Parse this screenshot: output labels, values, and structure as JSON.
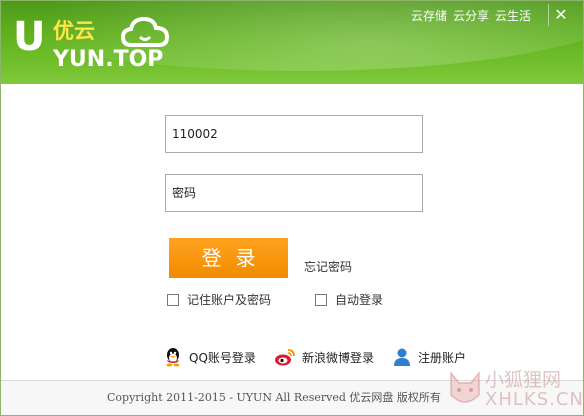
{
  "header": {
    "logo_cn": "优云",
    "logo_en": "YUN.TOP",
    "logo_u": "U",
    "links": [
      "云存储",
      "云分享",
      "云生活"
    ],
    "close": "✕"
  },
  "form": {
    "username_value": "110002",
    "password_placeholder": "密码",
    "login_label": "登录",
    "forgot_label": "忘记密码",
    "remember_label": "记住账户及密码",
    "auto_login_label": "自动登录"
  },
  "social": {
    "qq_label": "QQ账号登录",
    "weibo_label": "新浪微博登录",
    "register_label": "注册账户"
  },
  "footer": {
    "copyright": "Copyright 2011-2015 - UYUN All Reserved  优云网盘 版权所有"
  },
  "watermark": {
    "cn": "小狐狸网",
    "en": "XHLKS.CN"
  },
  "colors": {
    "header_green": "#62b31f",
    "login_orange": "#f59100"
  }
}
